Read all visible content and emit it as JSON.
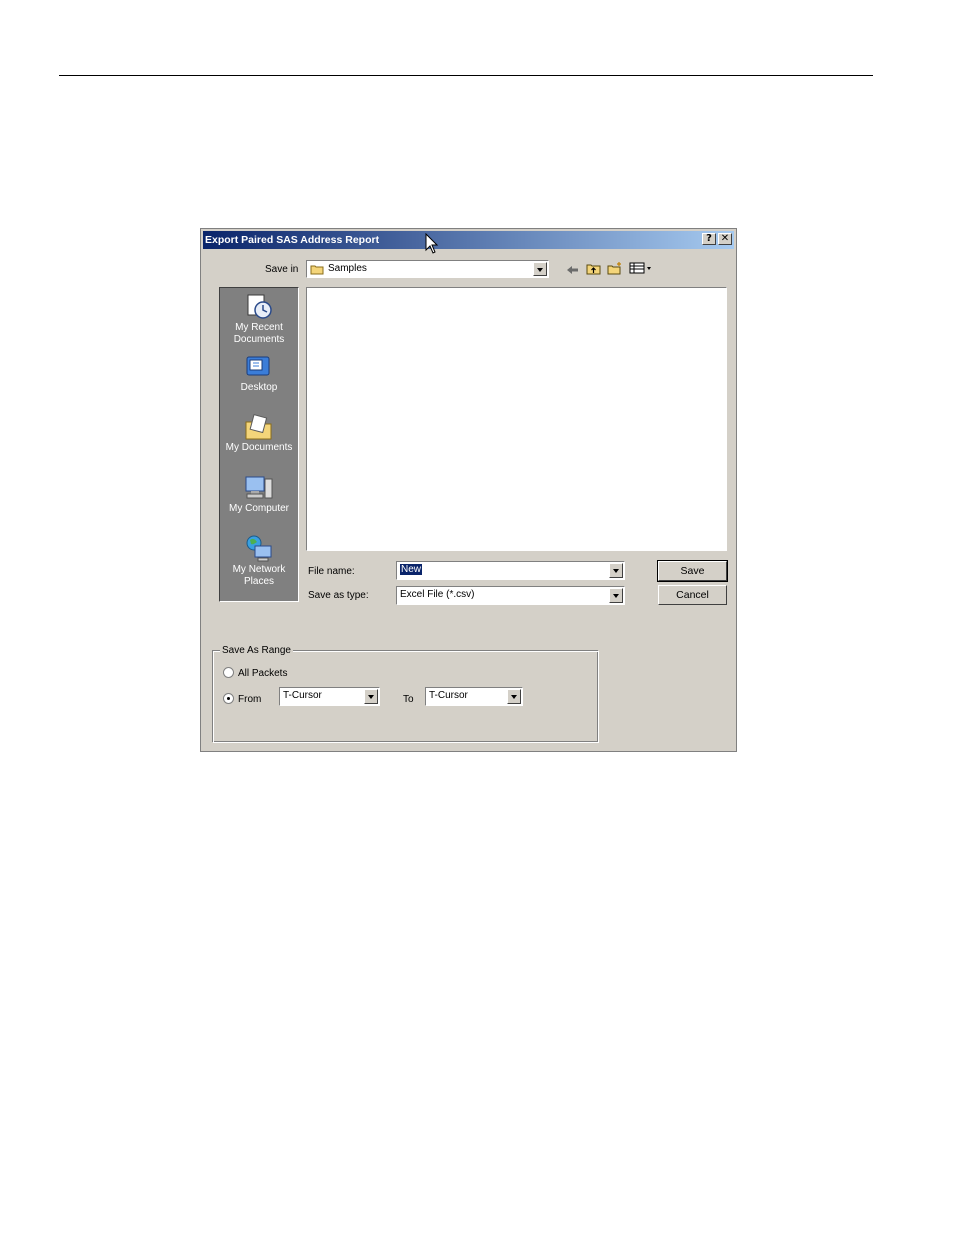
{
  "dialog": {
    "title": "Export Paired SAS Address Report",
    "help_label": "?",
    "close_label": "✕"
  },
  "save_in": {
    "label": "Save in",
    "value": "Samples"
  },
  "places": [
    {
      "label": "My Recent Documents",
      "icon": "recent-documents-icon"
    },
    {
      "label": "Desktop",
      "icon": "desktop-icon"
    },
    {
      "label": "My Documents",
      "icon": "my-documents-icon"
    },
    {
      "label": "My Computer",
      "icon": "my-computer-icon"
    },
    {
      "label": "My Network Places",
      "icon": "network-places-icon"
    }
  ],
  "file_name": {
    "label": "File name:",
    "value": "New"
  },
  "save_as_type": {
    "label": "Save as type:",
    "value": "Excel File (*.csv)"
  },
  "buttons": {
    "save": "Save",
    "cancel": "Cancel"
  },
  "range": {
    "title": "Save As Range",
    "all_packets": "All Packets",
    "from_label": "From",
    "from_value": "T-Cursor",
    "to_label": "To",
    "to_value": "T-Cursor",
    "selected": "from"
  },
  "colors": {
    "title_start": "#0a246a",
    "title_end": "#a6caf0",
    "dialog_face": "#d4d0c8",
    "places_bar": "#808080"
  }
}
